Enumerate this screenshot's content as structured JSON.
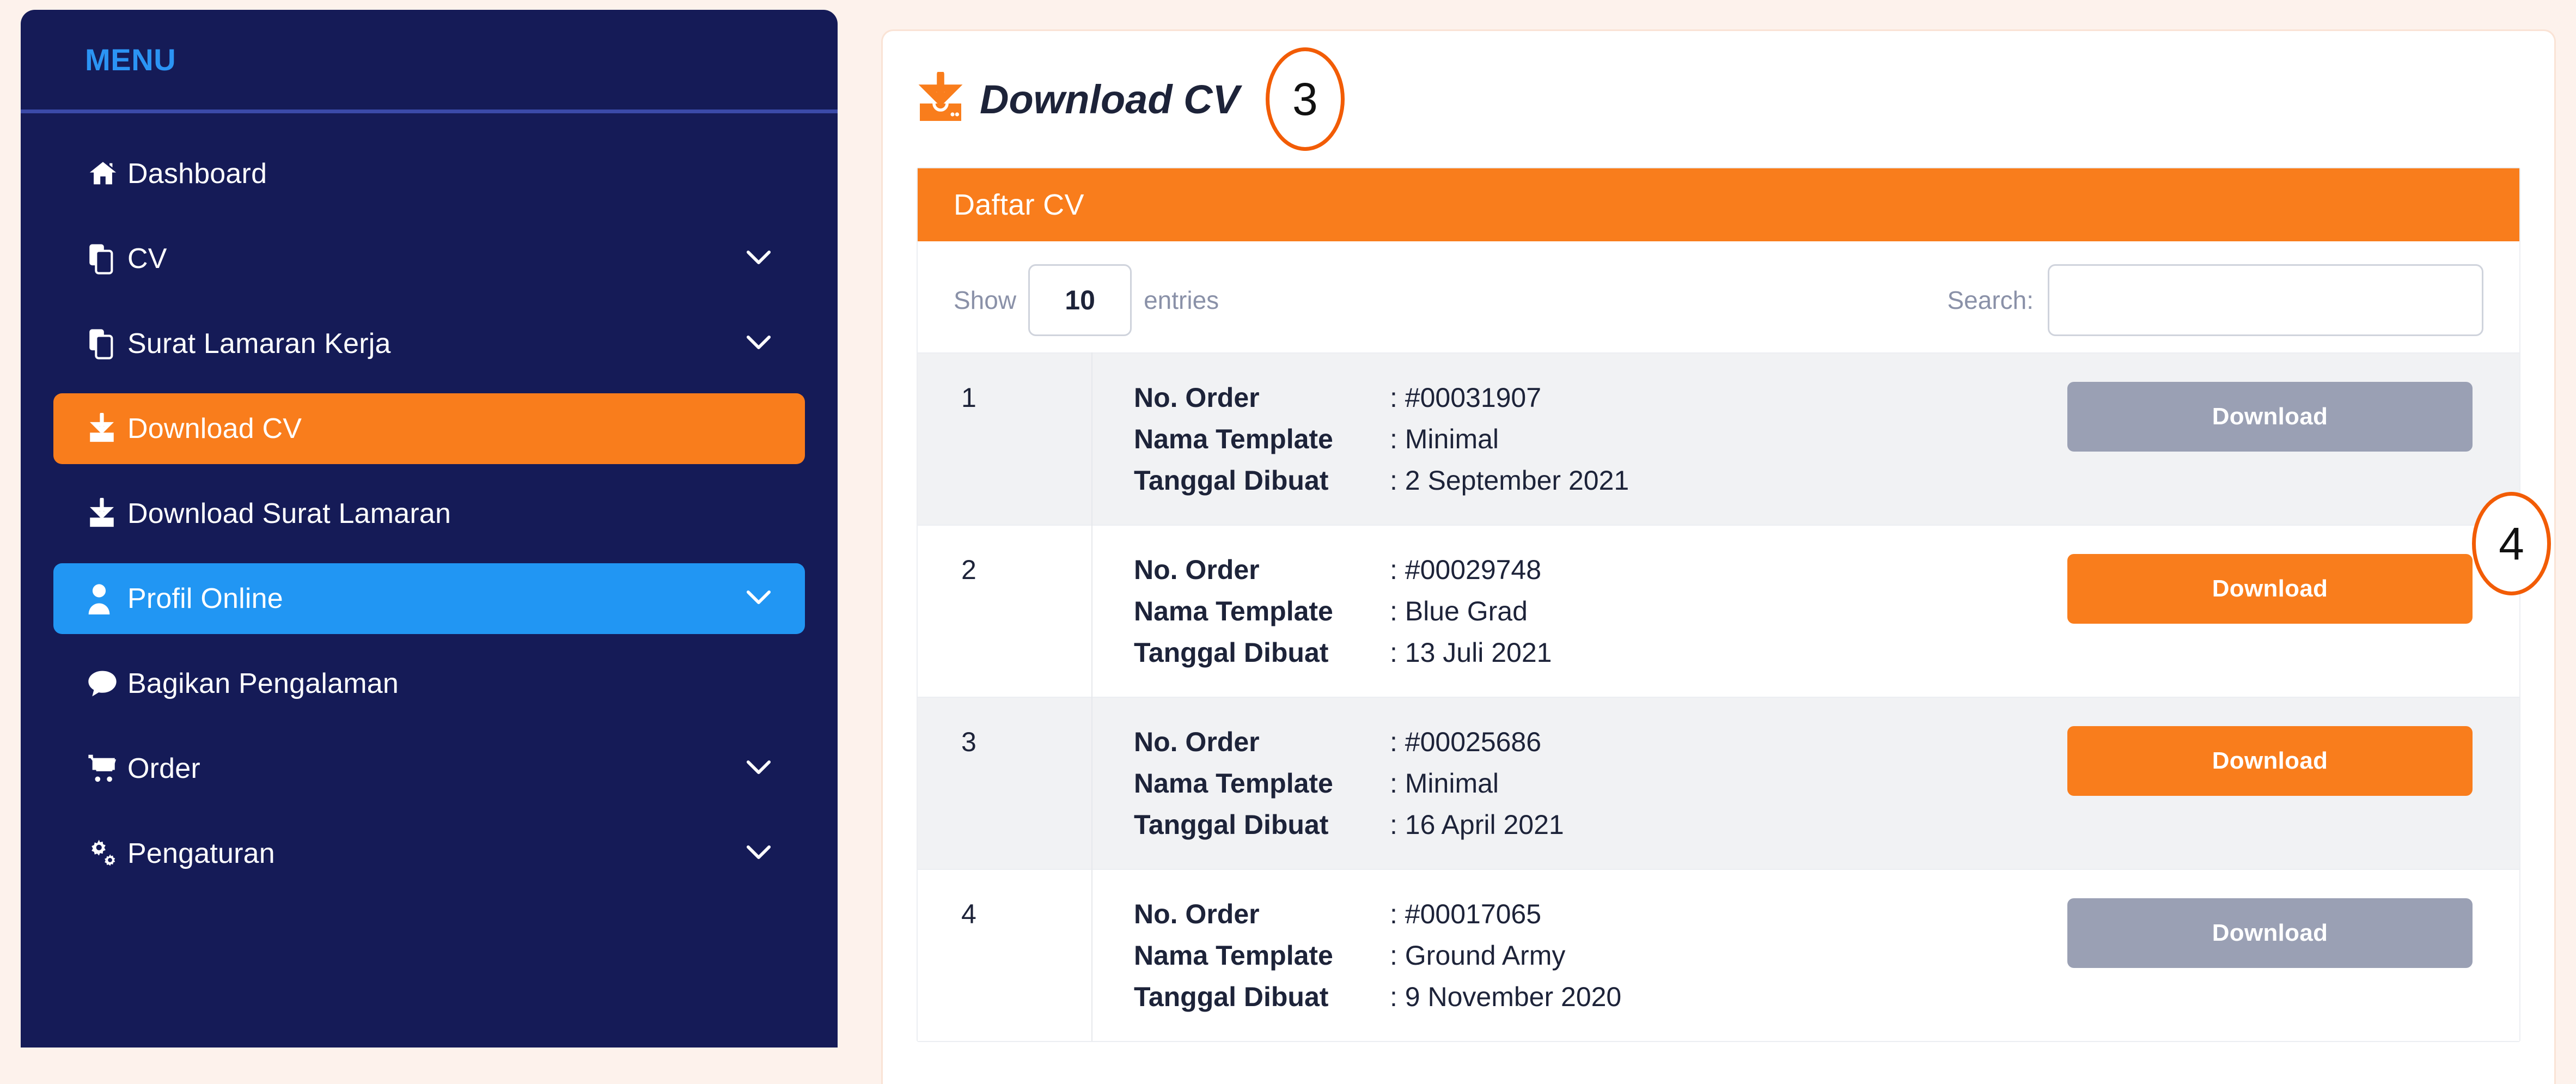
{
  "theme": {
    "page_bg": "#fdf2ec",
    "sidebar_bg": "#151b57",
    "accent_orange": "#f97d1c",
    "accent_blue": "#2196f3",
    "badge_ring": "#f25c05",
    "disabled_gray": "#9aa0b4"
  },
  "sidebar": {
    "heading": "MENU",
    "items": [
      {
        "label": "Dashboard",
        "icon": "home-icon",
        "chevron": false,
        "state": "default"
      },
      {
        "label": "CV",
        "icon": "copy-icon",
        "chevron": true,
        "state": "default"
      },
      {
        "label": "Surat Lamaran Kerja",
        "icon": "copy-icon",
        "chevron": true,
        "state": "default"
      },
      {
        "label": "Download CV",
        "icon": "download-icon",
        "chevron": false,
        "state": "active-orange"
      },
      {
        "label": "Download Surat Lamaran",
        "icon": "download-icon",
        "chevron": false,
        "state": "default"
      },
      {
        "label": "Profil Online",
        "icon": "user-icon",
        "chevron": true,
        "state": "active-blue"
      },
      {
        "label": "Bagikan Pengalaman",
        "icon": "comment-icon",
        "chevron": false,
        "state": "default"
      },
      {
        "label": "Order",
        "icon": "cart-icon",
        "chevron": true,
        "state": "default"
      },
      {
        "label": "Pengaturan",
        "icon": "cogs-icon",
        "chevron": true,
        "state": "default"
      }
    ]
  },
  "main": {
    "page_title": "Download CV",
    "page_title_icon": "download-box-icon",
    "step_badge_title": "3",
    "step_badge_row": "4",
    "card_title": "Daftar CV",
    "controls": {
      "show_label": "Show",
      "entries_value": "10",
      "entries_label": "entries",
      "search_label": "Search:",
      "search_value": "",
      "search_placeholder": ""
    },
    "row_keys": {
      "order": "No. Order",
      "template": "Nama Template",
      "date": "Tanggal Dibuat"
    },
    "download_label": "Download",
    "rows": [
      {
        "no": "1",
        "order": ": #00031907",
        "template": ": Minimal",
        "date": ": 2 September 2021",
        "button_state": "disabled",
        "shaded": true
      },
      {
        "no": "2",
        "order": ": #00029748",
        "template": ": Blue Grad",
        "date": ": 13 Juli 2021",
        "button_state": "enabled",
        "shaded": false
      },
      {
        "no": "3",
        "order": ": #00025686",
        "template": ": Minimal",
        "date": ": 16 April 2021",
        "button_state": "enabled",
        "shaded": true
      },
      {
        "no": "4",
        "order": ": #00017065",
        "template": ": Ground Army",
        "date": ": 9 November 2020",
        "button_state": "disabled",
        "shaded": false
      }
    ]
  }
}
